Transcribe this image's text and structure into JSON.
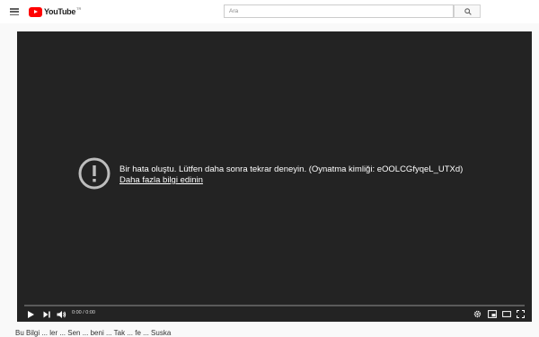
{
  "header": {
    "logo_text": "YouTube",
    "logo_country": "TR",
    "search": {
      "placeholder": "Ara",
      "value": ""
    },
    "icons": {
      "menu": "hamburger-menu-icon",
      "search": "search-icon"
    }
  },
  "player": {
    "error": {
      "message": "Bir hata oluştu. Lütfen daha sonra tekrar deneyin. (Oynatma kimliği: eOOLCGfyqeL_UTXd)",
      "link": "Daha fazla bilgi edinin",
      "icon": "alert-circle-icon"
    },
    "controls": {
      "time": "0:00 / 0:00",
      "progress": 0,
      "icons": [
        "play-icon",
        "next-icon",
        "volume-icon",
        "settings-icon",
        "miniplayer-icon",
        "theater-mode-icon",
        "fullscreen-icon"
      ]
    }
  },
  "below": {
    "title_partial": "Bu Bilgi ... ler ... Sen ... beni ... Tak ... fe ... Suska"
  },
  "colors": {
    "accent": "#ff0000",
    "player_bg": "#232323",
    "page_bg": "#f9f9f9"
  }
}
